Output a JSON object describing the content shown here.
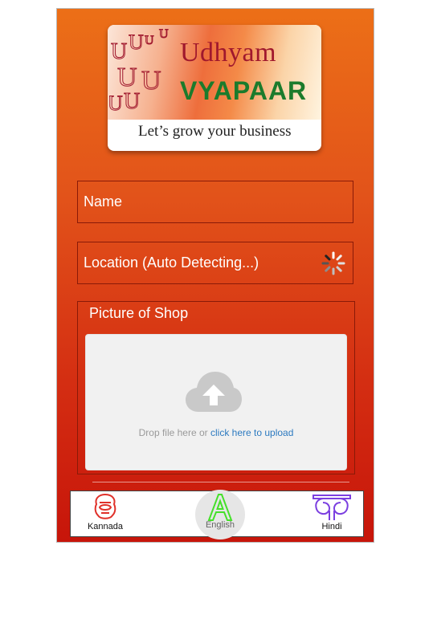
{
  "logo": {
    "brand_title": "Udhyam",
    "brand_subtitle": "VYAPAAR",
    "tagline": "Let’s grow your business",
    "glyph_letters": "U"
  },
  "form": {
    "name_placeholder": "Name",
    "location_placeholder": "Location (Auto Detecting...)",
    "picture_legend": "Picture of Shop",
    "drop_text": "Drop file here or ",
    "drop_link": "click here to upload"
  },
  "languages": [
    {
      "label": "Kannada",
      "icon": "kannada-letter-icon",
      "color": "#e0312a"
    },
    {
      "label": "English",
      "icon": "letter-a-icon",
      "color": "#45e02a",
      "selected": true
    },
    {
      "label": "Hindi",
      "icon": "devanagari-letter-icon",
      "color": "#7b3fe0"
    }
  ],
  "colors": {
    "background_top": "#ec6f17",
    "background_bottom": "#c7150a",
    "brand_red": "#a0182d",
    "brand_green": "#1b7b2c",
    "link_blue": "#2c7ac0"
  }
}
